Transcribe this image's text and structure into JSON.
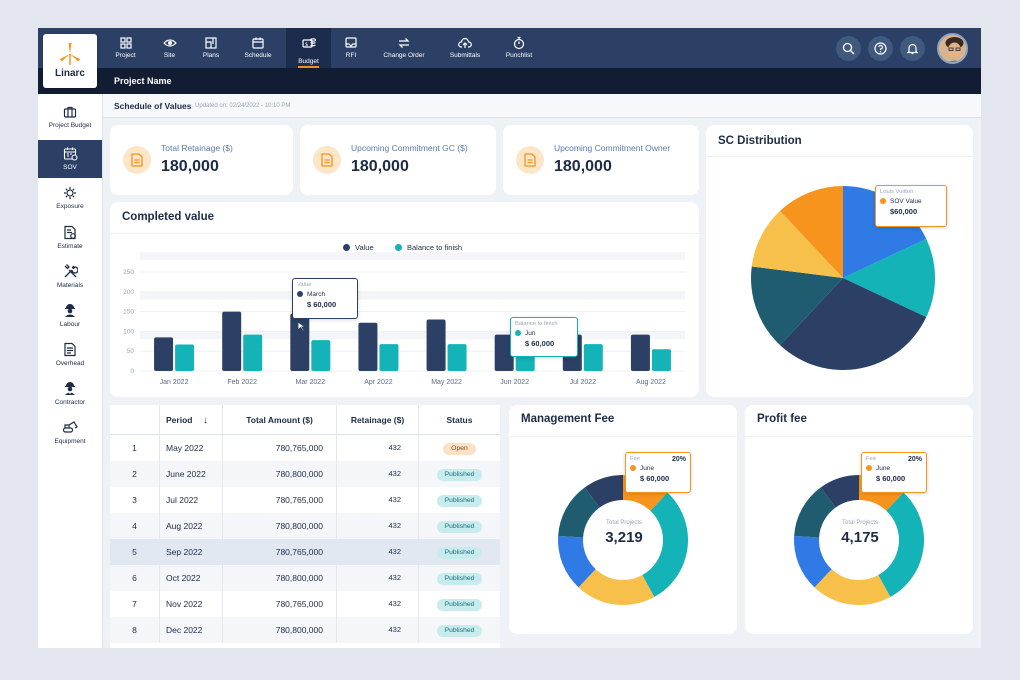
{
  "brand": {
    "name": "Linarc"
  },
  "topnav": {
    "items": [
      {
        "label": "Project",
        "icon": "grid-icon"
      },
      {
        "label": "Site",
        "icon": "eye-icon"
      },
      {
        "label": "Plans",
        "icon": "plans-icon"
      },
      {
        "label": "Schedule",
        "icon": "calendar-icon"
      },
      {
        "label": "Budget",
        "icon": "budget-icon",
        "active": true
      },
      {
        "label": "RFI",
        "icon": "rfi-icon"
      },
      {
        "label": "Change Order",
        "icon": "swap-icon"
      },
      {
        "label": "Submittals",
        "icon": "cloud-upload-icon"
      },
      {
        "label": "Punchlist",
        "icon": "stopwatch-icon"
      }
    ],
    "right_icons": [
      "search-icon",
      "help-icon",
      "bell-icon",
      "avatar"
    ]
  },
  "project": {
    "name": "Project Name"
  },
  "sidebar": {
    "items": [
      {
        "label": "Project Budget",
        "icon": "briefcase-icon"
      },
      {
        "label": "SOV",
        "icon": "calendar-dollar-icon",
        "active": true
      },
      {
        "label": "Exposure",
        "icon": "gear-dollar-icon"
      },
      {
        "label": "Estimate",
        "icon": "document-dollar-icon"
      },
      {
        "label": "Materials",
        "icon": "tools-icon"
      },
      {
        "label": "Labour",
        "icon": "worker-icon"
      },
      {
        "label": "Overhead",
        "icon": "document-icon"
      },
      {
        "label": "Contractor",
        "icon": "contractor-icon"
      },
      {
        "label": "Equipment",
        "icon": "excavator-icon"
      }
    ]
  },
  "sov": {
    "title": "Schedule of Values",
    "updated": "Updated on: 02/24/2022 - 10:10 PM"
  },
  "kpis": [
    {
      "label": "Total Retainage ($)",
      "value": "180,000"
    },
    {
      "label": "Upcoming Commitment GC ($)",
      "value": "180,000"
    },
    {
      "label": "Upcoming Commitment Owner",
      "value": "180,000"
    }
  ],
  "colors": {
    "navy": "#2c4066",
    "teal": "#13b3b8",
    "orange": "#f7941d",
    "yellow": "#f7c04a",
    "blue": "#2f7ae5",
    "dark_teal": "#1f5c70"
  },
  "completed": {
    "title": "Completed value",
    "legend": [
      "Value",
      "Balance to finish"
    ],
    "tooltip_value": {
      "title": "Value",
      "label": "March",
      "amount": "$ 60,000"
    },
    "tooltip_balance": {
      "title": "Balance to finish",
      "label": "Jun",
      "amount": "$ 60,000"
    }
  },
  "chart_data": {
    "type": "bar",
    "categories": [
      "Jan 2022",
      "Feb 2022",
      "Mar 2022",
      "Apr 2022",
      "May 2022",
      "Jun 2022",
      "Jul 2022",
      "Aug 2022"
    ],
    "series": [
      {
        "name": "Value",
        "values": [
          85,
          150,
          145,
          122,
          130,
          92,
          92,
          92
        ]
      },
      {
        "name": "Balance to finish",
        "values": [
          67,
          92,
          78,
          68,
          68,
          57,
          68,
          55
        ]
      }
    ],
    "yticks": [
      0,
      50,
      100,
      150,
      200,
      250
    ],
    "ylim": [
      0,
      250
    ],
    "grid": true,
    "legend_position": "top-center"
  },
  "sc_distribution": {
    "title": "SC Distribution",
    "tooltip": {
      "title": "Louis Vuitton",
      "label": "SOV Value",
      "amount": "$60,000"
    },
    "slices": [
      {
        "value": 18,
        "color": "#2f7ae5"
      },
      {
        "value": 14,
        "color": "#13b3b8"
      },
      {
        "value": 30,
        "color": "#2c4066"
      },
      {
        "value": 15,
        "color": "#1f5c70"
      },
      {
        "value": 11,
        "color": "#f7c04a"
      },
      {
        "value": 12,
        "color": "#f7941d"
      }
    ]
  },
  "table": {
    "headers": [
      "Period",
      "Total Amount ($)",
      "Retainage ($)",
      "Status"
    ],
    "rows": [
      {
        "no": "1",
        "period": "May 2022",
        "amount": "780,765,000",
        "retainage": "432",
        "status": "Open"
      },
      {
        "no": "2",
        "period": "June 2022",
        "amount": "780,800,000",
        "retainage": "432",
        "status": "Published"
      },
      {
        "no": "3",
        "period": "Jul 2022",
        "amount": "780,765,000",
        "retainage": "432",
        "status": "Published"
      },
      {
        "no": "4",
        "period": "Aug 2022",
        "amount": "780,800,000",
        "retainage": "432",
        "status": "Published"
      },
      {
        "no": "5",
        "period": "Sep 2022",
        "amount": "780,765,000",
        "retainage": "432",
        "status": "Published"
      },
      {
        "no": "6",
        "period": "Oct 2022",
        "amount": "780,800,000",
        "retainage": "432",
        "status": "Published"
      },
      {
        "no": "7",
        "period": "Nov 2022",
        "amount": "780,765,000",
        "retainage": "432",
        "status": "Published"
      },
      {
        "no": "8",
        "period": "Dec 2022",
        "amount": "780,800,000",
        "retainage": "432",
        "status": "Published"
      }
    ]
  },
  "management_fee": {
    "title": "Management Fee",
    "center_label": "Total Projects",
    "center_value": "3,219",
    "tooltip": {
      "title": "Fee",
      "percent": "20%",
      "label": "June",
      "amount": "$ 60,000"
    },
    "slices": [
      {
        "value": 12,
        "color": "#f7941d"
      },
      {
        "value": 30,
        "color": "#13b3b8"
      },
      {
        "value": 20,
        "color": "#f7c04a"
      },
      {
        "value": 14,
        "color": "#2f7ae5"
      },
      {
        "value": 14,
        "color": "#1f5c70"
      },
      {
        "value": 10,
        "color": "#2c4066"
      }
    ]
  },
  "profit_fee": {
    "title": "Profit fee",
    "center_label": "Total Projects",
    "center_value": "4,175",
    "tooltip": {
      "title": "Fee",
      "percent": "20%",
      "label": "June",
      "amount": "$ 60,000"
    },
    "slices": [
      {
        "value": 12,
        "color": "#f7941d"
      },
      {
        "value": 30,
        "color": "#13b3b8"
      },
      {
        "value": 20,
        "color": "#f7c04a"
      },
      {
        "value": 14,
        "color": "#2f7ae5"
      },
      {
        "value": 14,
        "color": "#1f5c70"
      },
      {
        "value": 10,
        "color": "#2c4066"
      }
    ]
  }
}
